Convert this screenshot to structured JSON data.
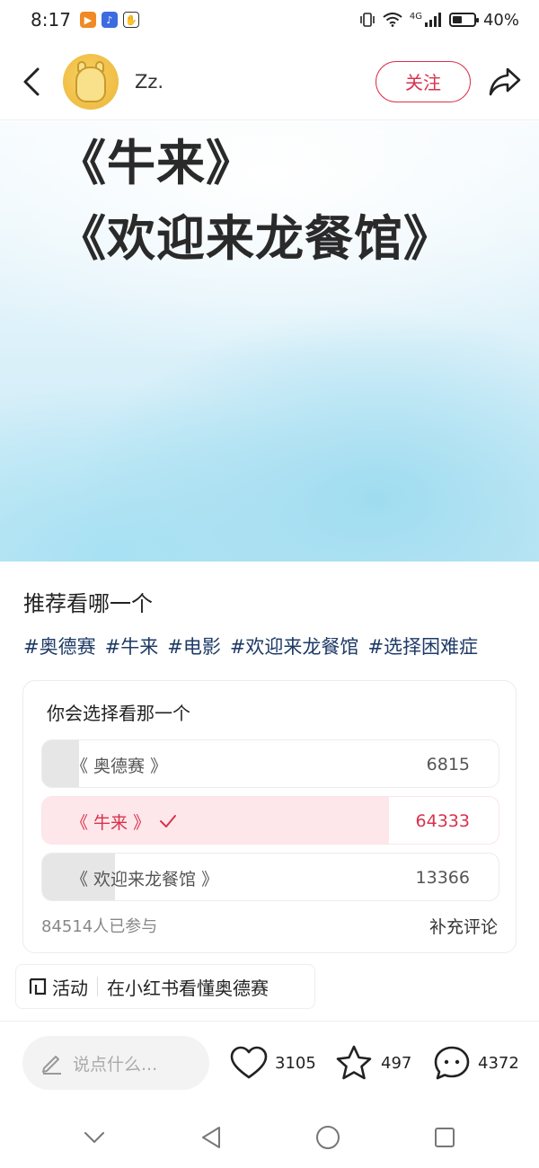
{
  "status_bar": {
    "time": "8:17",
    "network": "4G",
    "battery": "40%",
    "battery_level": 0.4
  },
  "header": {
    "username": "Zz.",
    "follow_label": "关注"
  },
  "hero": {
    "line1": "《牛来》",
    "line2": "《欢迎来龙餐馆》"
  },
  "post": {
    "title": "推荐看哪一个",
    "tags": [
      "#奥德赛",
      "#牛来",
      "#电影",
      "#欢迎来龙餐馆",
      "#选择困难症"
    ]
  },
  "poll": {
    "question": "你会选择看那一个",
    "options": [
      {
        "label": "《 奥德赛 》",
        "count": "6815",
        "fraction": 0.08,
        "selected": false
      },
      {
        "label": "《 牛来 》",
        "count": "64333",
        "fraction": 0.76,
        "selected": true
      },
      {
        "label": "《 欢迎来龙餐馆 》",
        "count": "13366",
        "fraction": 0.16,
        "selected": false
      }
    ],
    "participants": "84514人已参与",
    "comment_label": "补充评论"
  },
  "activity": {
    "badge": "活动",
    "text": "在小红书看懂奥德赛"
  },
  "bottom_bar": {
    "comment_placeholder": "说点什么...",
    "likes": "3105",
    "favorites": "497",
    "comments": "4372"
  },
  "colors": {
    "accent": "#d9324c",
    "tag": "#1e3a66",
    "selected_fill": "#fde7ea",
    "bar_fill": "#e6e6e6"
  },
  "icons": {
    "back": "back-arrow-icon",
    "share": "share-icon",
    "edit": "pencil-icon",
    "like": "heart-icon",
    "favorite": "star-icon",
    "comment": "comment-bubble-icon"
  }
}
